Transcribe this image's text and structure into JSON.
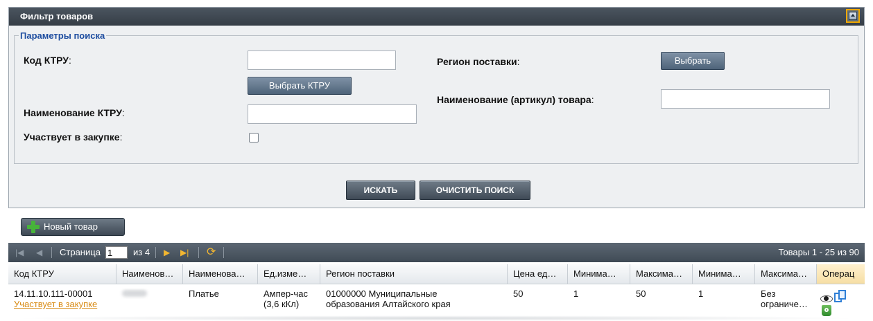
{
  "panel": {
    "title": "Фильтр товаров",
    "legend": "Параметры поиска",
    "fields": {
      "ktru_code_label": "Код КТРУ",
      "ktru_name_label": "Наименование КТРУ",
      "participates_label": "Участвует в закупке",
      "region_label": "Регион поставки",
      "article_label": "Наименование (артикул) товара",
      "colon": ":"
    },
    "inputs": {
      "ktru_code_value": "",
      "ktru_name_value": "",
      "article_value": ""
    },
    "buttons": {
      "select_ktru": "Выбрать КТРУ",
      "select_region": "Выбрать",
      "search": "ИСКАТЬ",
      "clear": "ОЧИСТИТЬ ПОИСК"
    }
  },
  "toolbar": {
    "new_item": "Новый товар"
  },
  "pager": {
    "page_label": "Страница",
    "page_value": "1",
    "of_label": "из 4",
    "summary": "Товары 1 - 25 из 90"
  },
  "table": {
    "columns": [
      "Код КТРУ",
      "Наименов…",
      "Наименова…",
      "Ед.изме…",
      "Регион поставки",
      "Цена ед…",
      "Минима…",
      "Максима…",
      "Минима…",
      "Максима…",
      "Операц"
    ],
    "rows": [
      {
        "ktru_code": "14.11.10.111-00001",
        "participates_link": "Участвует в закупке",
        "name": "Платье",
        "unit_line1": "Ампер-час",
        "unit_line2": "(3,6 кКл)",
        "region_line1": "01000000 Муниципальные",
        "region_line2": "образования Алтайского края",
        "price": "50",
        "min1": "1",
        "max1": "50",
        "min2": "1",
        "max2_line1": "Без",
        "max2_line2": "ограниче…"
      }
    ]
  },
  "icons": {
    "collapse": "collapse-up-icon",
    "new": "plus-icon",
    "first": "first-page-icon",
    "prev": "prev-page-icon",
    "next": "next-page-icon",
    "last": "last-page-icon",
    "refresh": "refresh-icon",
    "view": "eye-icon",
    "copy": "copy-icon",
    "delete": "trash-icon"
  },
  "colors": {
    "header_bg": "#3f4a55",
    "legend": "#1f4ea0",
    "link": "#d88a12",
    "focus_border": "#f0a800",
    "ops_header": "#f6dea4"
  }
}
